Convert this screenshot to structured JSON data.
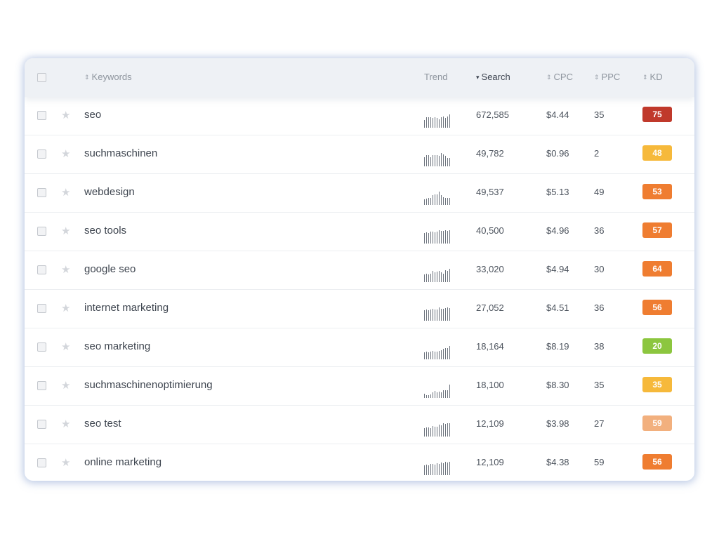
{
  "table": {
    "columns": {
      "keywords": "Keywords",
      "trend": "Trend",
      "search": "Search",
      "cpc": "CPC",
      "ppc": "PPC",
      "kd": "KD"
    },
    "sort_column": "search",
    "sort_direction": "descending",
    "rows": [
      {
        "keyword": "seo",
        "search": "672,585",
        "cpc": "$4.44",
        "ppc": "35",
        "kd": "75",
        "kd_color": "#c0392b",
        "trend": [
          0.55,
          0.75,
          0.75,
          0.75,
          0.7,
          0.75,
          0.7,
          0.6,
          0.75,
          0.85,
          0.7,
          0.8,
          1.0
        ]
      },
      {
        "keyword": "suchmaschinen",
        "search": "49,782",
        "cpc": "$0.96",
        "ppc": "2",
        "kd": "48",
        "kd_color": "#f6b93b",
        "trend": [
          0.65,
          0.8,
          0.8,
          0.65,
          0.85,
          0.8,
          0.8,
          0.75,
          1.0,
          0.9,
          0.75,
          0.6,
          0.6
        ]
      },
      {
        "keyword": "webdesign",
        "search": "49,537",
        "cpc": "$5.13",
        "ppc": "49",
        "kd": "53",
        "kd_color": "#ef7d31",
        "trend": [
          0.35,
          0.4,
          0.45,
          0.45,
          0.7,
          0.75,
          0.75,
          1.0,
          0.7,
          0.5,
          0.45,
          0.45,
          0.45
        ]
      },
      {
        "keyword": "seo tools",
        "search": "40,500",
        "cpc": "$4.96",
        "ppc": "36",
        "kd": "57",
        "kd_color": "#ef7d31",
        "trend": [
          0.75,
          0.85,
          0.75,
          0.9,
          0.9,
          0.85,
          0.9,
          1.0,
          0.95,
          0.95,
          1.0,
          0.95,
          1.0
        ]
      },
      {
        "keyword": "google seo",
        "search": "33,020",
        "cpc": "$4.94",
        "ppc": "30",
        "kd": "64",
        "kd_color": "#ef7d31",
        "trend": [
          0.5,
          0.6,
          0.55,
          0.6,
          0.8,
          0.7,
          0.75,
          0.85,
          0.7,
          0.6,
          0.9,
          0.8,
          1.0
        ]
      },
      {
        "keyword": "internet marketing",
        "search": "27,052",
        "cpc": "$4.51",
        "ppc": "36",
        "kd": "56",
        "kd_color": "#ef7d31",
        "trend": [
          0.75,
          0.85,
          0.75,
          0.8,
          0.9,
          0.8,
          0.85,
          1.0,
          0.9,
          0.9,
          0.95,
          1.0,
          0.95
        ]
      },
      {
        "keyword": "seo marketing",
        "search": "18,164",
        "cpc": "$8.19",
        "ppc": "38",
        "kd": "20",
        "kd_color": "#8cc63f",
        "trend": [
          0.45,
          0.5,
          0.45,
          0.55,
          0.6,
          0.5,
          0.55,
          0.6,
          0.65,
          0.75,
          0.8,
          0.85,
          1.0
        ]
      },
      {
        "keyword": "suchmaschinenoptimierung",
        "search": "18,100",
        "cpc": "$8.30",
        "ppc": "35",
        "kd": "35",
        "kd_color": "#f6b93b",
        "trend": [
          0.25,
          0.1,
          0.1,
          0.15,
          0.35,
          0.45,
          0.35,
          0.4,
          0.35,
          0.5,
          0.55,
          0.55,
          1.0
        ]
      },
      {
        "keyword": "seo test",
        "search": "12,109",
        "cpc": "$3.98",
        "ppc": "27",
        "kd": "59",
        "kd_color": "#f2b07e",
        "trend": [
          0.6,
          0.65,
          0.65,
          0.6,
          0.75,
          0.7,
          0.7,
          0.9,
          0.85,
          1.0,
          0.95,
          1.0,
          1.0
        ]
      },
      {
        "keyword": "online marketing",
        "search": "12,109",
        "cpc": "$4.38",
        "ppc": "59",
        "kd": "56",
        "kd_color": "#ef7d31",
        "trend": [
          0.7,
          0.75,
          0.7,
          0.8,
          0.85,
          0.75,
          0.9,
          0.85,
          0.95,
          0.9,
          1.0,
          0.95,
          1.0
        ]
      }
    ]
  }
}
